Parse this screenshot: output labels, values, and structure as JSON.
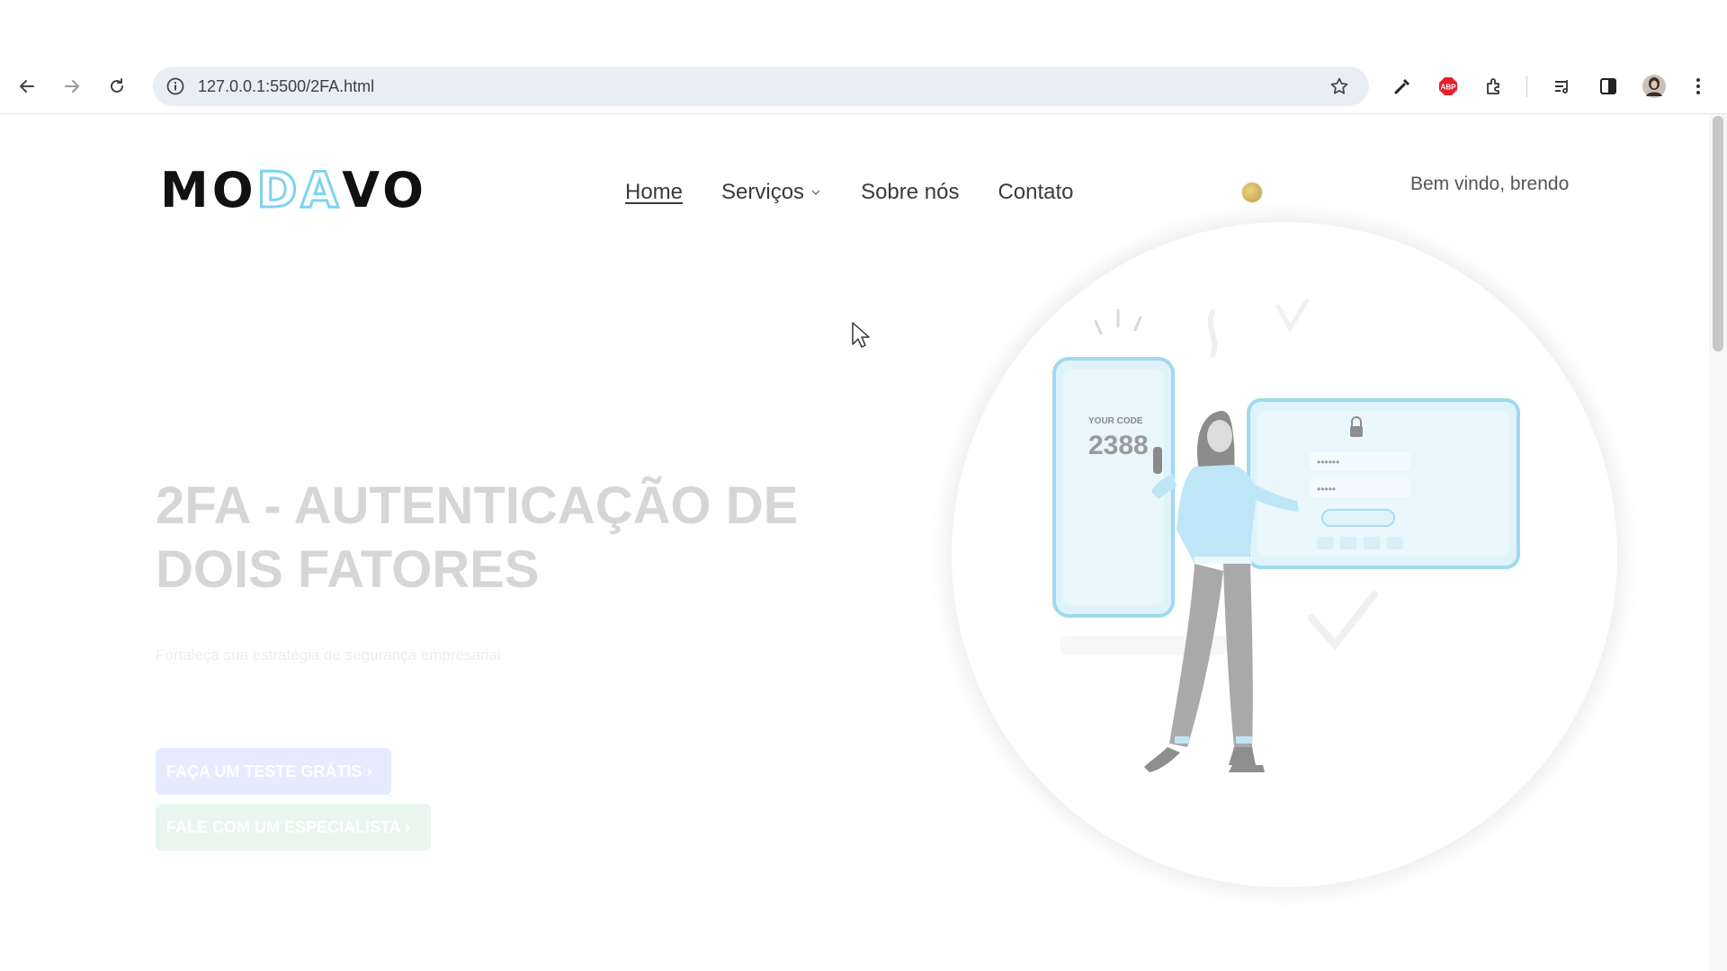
{
  "browser": {
    "url": "127.0.0.1:5500/2FA.html",
    "icons": [
      "back-icon",
      "forward-icon",
      "reload-icon",
      "site-info-icon",
      "bookmark-star-icon",
      "eyedropper-icon",
      "adblock-icon",
      "extensions-icon",
      "reading-list-icon",
      "side-panel-icon",
      "profile-avatar",
      "menu-kebab-icon"
    ],
    "adblock_label": "ABP"
  },
  "header": {
    "logo": {
      "part1": "MO",
      "part2": "DA",
      "part3": "VO"
    },
    "nav": {
      "home": "Home",
      "servicos": "Serviços",
      "sobre": "Sobre nós",
      "contato": "Contato"
    },
    "welcome": "Bem vindo, brendo"
  },
  "hero": {
    "title": "2FA - AUTENTICAÇÃO DE DOIS FATORES",
    "subtitle": "Fortaleça sua estratégia de segurança empresarial",
    "cta_primary": "FAÇA UM TESTE GRÁTIS ›",
    "cta_secondary": "FALE COM UM ESPECIALISTA ›",
    "illustration": {
      "phone_label": "YOUR CODE",
      "code": "2388",
      "password_mask_1": "••••••",
      "password_mask_2": "•••••"
    }
  },
  "colors": {
    "logo_accent": "#7ed3f0",
    "device_fill": "#dff3fb",
    "device_stroke": "#9fdaf0",
    "primary_button": "#e6ebff",
    "secondary_button": "#e9f6ef"
  }
}
